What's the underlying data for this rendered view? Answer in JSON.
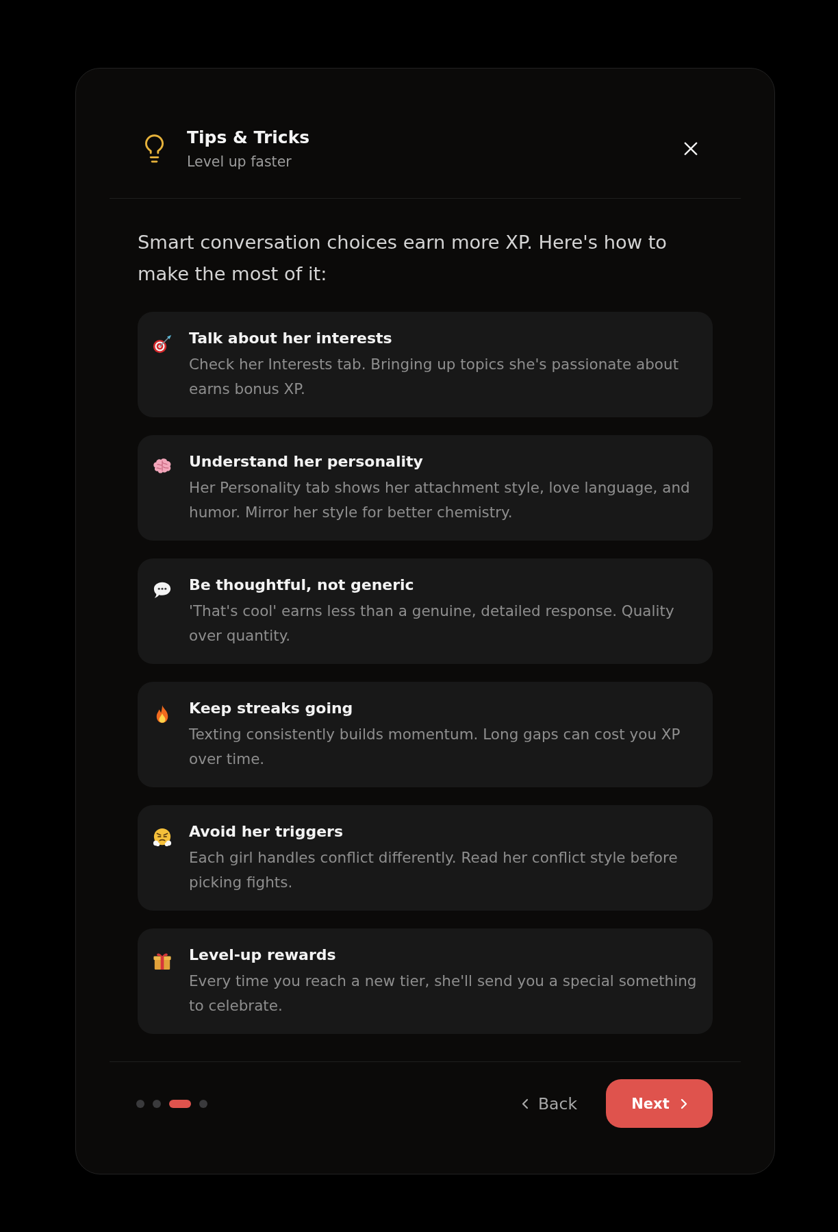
{
  "dialog": {
    "title": "Tips & Tricks",
    "subtitle": "Level up faster"
  },
  "intro": "Smart conversation choices earn more XP. Here's how to make the most of it:",
  "tips": [
    {
      "title": "Talk about her interests",
      "description": "Check her Interests tab. Bringing up topics she's passionate about earns bonus XP."
    },
    {
      "title": "Understand her personality",
      "description": "Her Personality tab shows her attachment style, love language, and humor. Mirror her style for better chemistry."
    },
    {
      "title": "Be thoughtful, not generic",
      "description": "'That's cool' earns less than a genuine, detailed response. Quality over quantity."
    },
    {
      "title": "Keep streaks going",
      "description": "Texting consistently builds momentum. Long gaps can cost you XP over time."
    },
    {
      "title": "Avoid her triggers",
      "description": "Each girl handles conflict differently. Read her conflict style before picking fights."
    },
    {
      "title": "Level-up rewards",
      "description": "Every time you reach a new tier, she'll send you a special something to celebrate."
    }
  ],
  "pagination": {
    "pages": [
      {
        "selected": false
      },
      {
        "selected": false
      },
      {
        "selected": true
      },
      {
        "selected": false
      }
    ]
  },
  "buttons": {
    "back": "Back",
    "next": "Next"
  }
}
